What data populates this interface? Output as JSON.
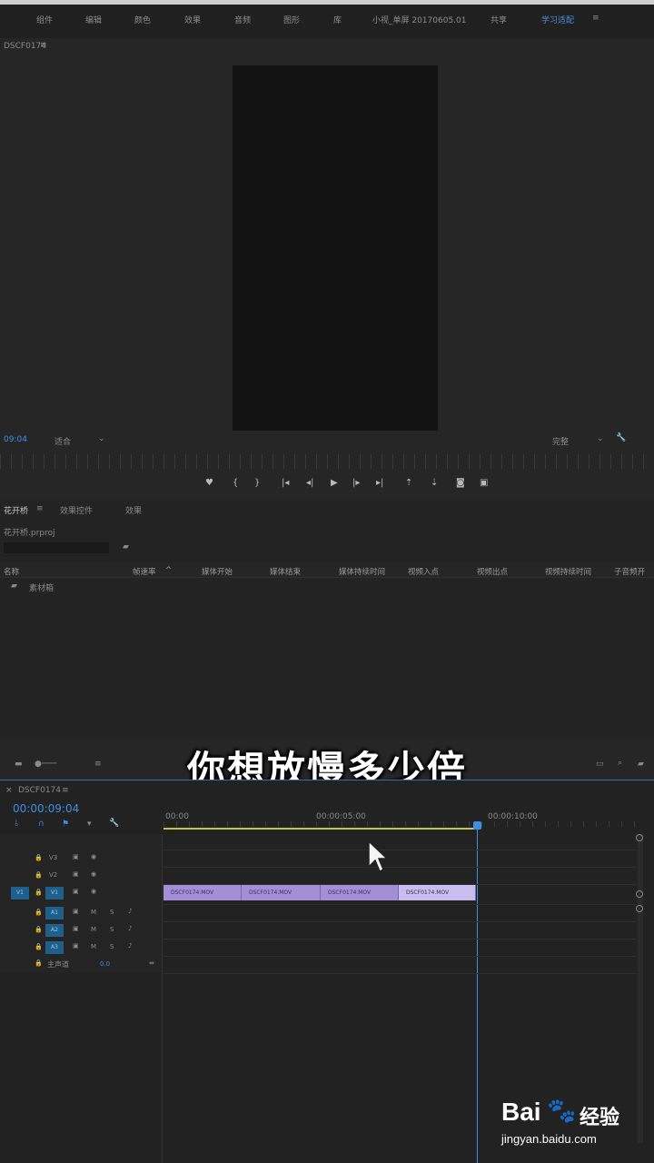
{
  "menu": {
    "items": [
      "组件",
      "编辑",
      "颜色",
      "效果",
      "音频",
      "图形",
      "库",
      "小视_单屏 20170605.01",
      "共享",
      "学习适配"
    ]
  },
  "monitor": {
    "tab_label": "DSCF0174",
    "timecode": "09:04",
    "fit_label": "适合",
    "quality_label": "完整"
  },
  "project": {
    "tabs": [
      "花开桥",
      "效果控件",
      "效果"
    ],
    "file_name": "花开桥.prproj",
    "columns": [
      "名称",
      "帧速率",
      "媒体开始",
      "媒体结束",
      "媒体持续时间",
      "视频入点",
      "视频出点",
      "视频持续时间",
      "子音频开"
    ],
    "bin_label": "素材箱"
  },
  "subtitle": "你想放慢多少倍",
  "timeline": {
    "tab_label": "DSCF0174",
    "timecode": "00:00:09:04",
    "ruler": [
      "00:00",
      "00:00:05:00",
      "00:00:10:00"
    ],
    "tracks_video": [
      "V3",
      "V2",
      "V1"
    ],
    "tracks_audio": [
      "A1",
      "A2",
      "A3"
    ],
    "master_label": "主声道",
    "master_value": "0.0",
    "clips": [
      "DSCF0174.MOV",
      "DSCF0174.MOV",
      "DSCF0174.MOV",
      "DSCF0174.MOV"
    ]
  },
  "watermark": {
    "brand": "Bai",
    "brand2": "经验",
    "url": "jingyan.baidu.com"
  }
}
